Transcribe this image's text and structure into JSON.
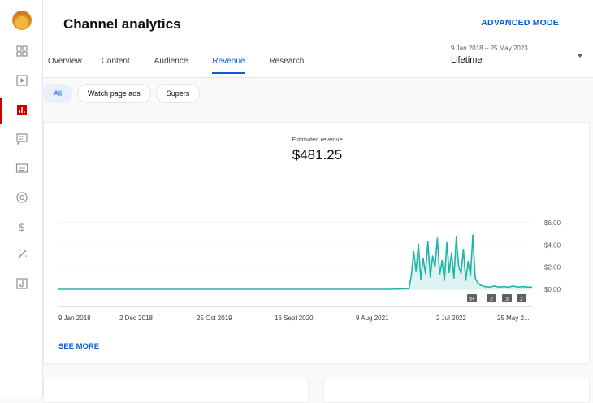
{
  "app": {
    "title": "Channel analytics",
    "advanced_mode": "ADVANCED MODE"
  },
  "sidebar": {
    "items": [
      {
        "icon": "dashboard-icon"
      },
      {
        "icon": "content-icon"
      },
      {
        "icon": "analytics-icon",
        "active": true
      },
      {
        "icon": "comments-icon"
      },
      {
        "icon": "subtitles-icon"
      },
      {
        "icon": "copyright-icon"
      },
      {
        "icon": "earn-icon"
      },
      {
        "icon": "customization-icon"
      },
      {
        "icon": "audio-library-icon"
      }
    ]
  },
  "tabs": [
    {
      "label": "Overview"
    },
    {
      "label": "Content"
    },
    {
      "label": "Audience"
    },
    {
      "label": "Revenue",
      "active": true
    },
    {
      "label": "Research"
    }
  ],
  "date_picker": {
    "range": "9 Jan 2018 – 25 May 2023",
    "value": "Lifetime"
  },
  "chips": [
    {
      "label": "All",
      "active": true
    },
    {
      "label": "Watch page ads"
    },
    {
      "label": "Supers"
    }
  ],
  "metric": {
    "label": "Estimated revenue",
    "value": "$481.25"
  },
  "see_more": "SEE MORE",
  "colors": {
    "accent": "#065fd4",
    "line": "#1fb5a6",
    "area": "#d5f0ed",
    "active_nav": "#cc0000"
  },
  "chart_data": {
    "type": "line",
    "series_color": "#1fb5a6",
    "ylim": [
      0,
      6
    ],
    "y_ticks": [
      "$6.00",
      "$4.00",
      "$2.00",
      "$0.00"
    ],
    "y_tick_values": [
      6,
      4,
      2,
      0
    ],
    "x_ticks": [
      "9 Jan 2018",
      "2 Dec 2018",
      "25 Oct 2019",
      "16 Sept 2020",
      "9 Aug 2021",
      "2 Jul 2022",
      "25 May 2..."
    ],
    "markers": [
      "9+",
      "2",
      "3",
      "2"
    ],
    "values_note": "near-zero until early 2022, spiky $1–5 through late 2022, then ~$0.20",
    "x": [
      0,
      0.05,
      0.1,
      0.15,
      0.2,
      0.25,
      0.3,
      0.35,
      0.4,
      0.45,
      0.5,
      0.55,
      0.6,
      0.65,
      0.7,
      0.74,
      0.745,
      0.75,
      0.755,
      0.76,
      0.765,
      0.77,
      0.775,
      0.78,
      0.785,
      0.79,
      0.795,
      0.8,
      0.805,
      0.81,
      0.815,
      0.82,
      0.825,
      0.83,
      0.835,
      0.84,
      0.845,
      0.85,
      0.855,
      0.86,
      0.865,
      0.87,
      0.875,
      0.88,
      0.885,
      0.89,
      0.895,
      0.9,
      0.91,
      0.92,
      0.93,
      0.94,
      0.95,
      0.96,
      0.97,
      0.98,
      0.99,
      1.0
    ],
    "y": [
      0,
      0,
      0,
      0,
      0,
      0,
      0,
      0,
      0,
      0,
      0,
      0,
      0,
      0,
      0,
      0.05,
      1.2,
      3.4,
      1.6,
      4.1,
      0.9,
      2.8,
      1.4,
      4.3,
      1.1,
      3.0,
      2.0,
      4.6,
      1.3,
      2.6,
      0.8,
      4.2,
      1.5,
      3.3,
      1.0,
      4.7,
      2.1,
      1.4,
      3.6,
      0.8,
      2.5,
      1.2,
      4.9,
      1.0,
      0.6,
      0.4,
      0.3,
      0.25,
      0.2,
      0.3,
      0.2,
      0.25,
      0.2,
      0.3,
      0.2,
      0.25,
      0.2,
      0.2
    ]
  }
}
